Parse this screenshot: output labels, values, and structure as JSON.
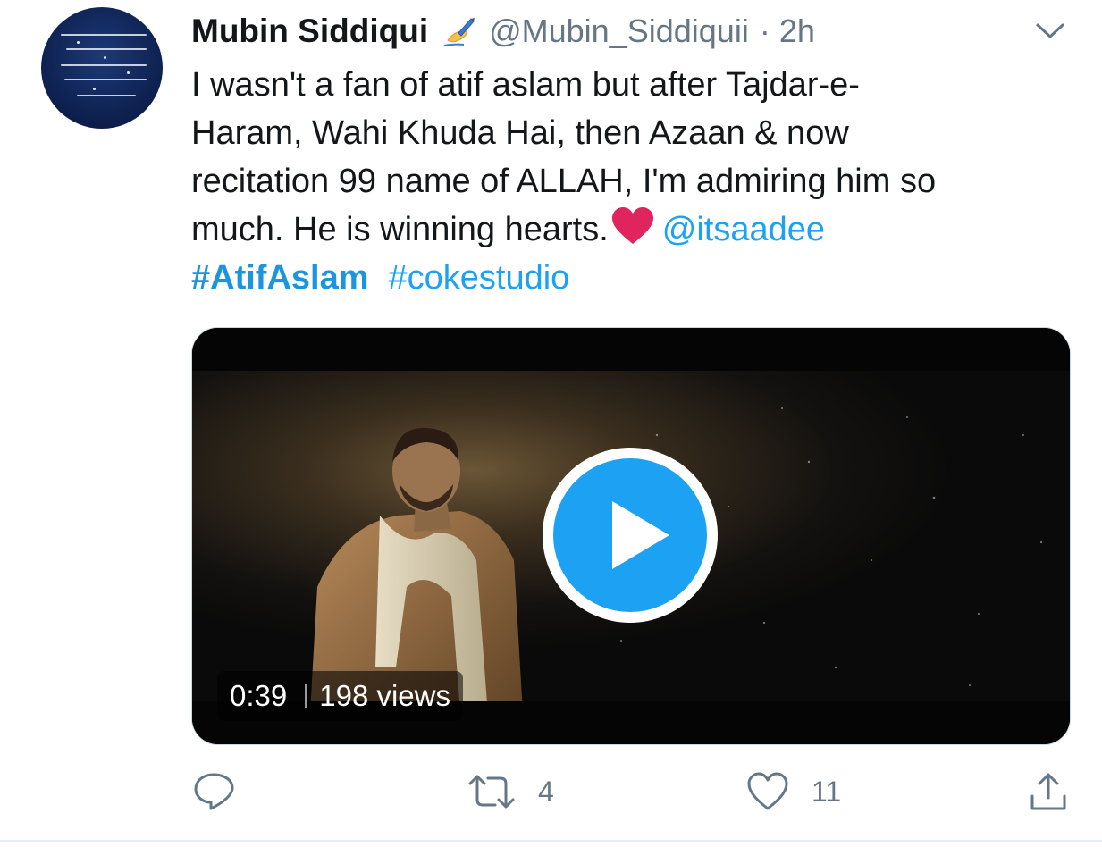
{
  "tweet": {
    "author_name": "Mubin Siddiqui",
    "author_handle": "@Mubin_Siddiquii",
    "separator": "·",
    "time": "2h",
    "avatar_icon": "calligraphy-avatar-icon",
    "name_emoji": "writing-hand-icon",
    "text_lines": [
      "I wasn't a fan of atif aslam but after Tajdar-e-",
      "Haram, Wahi Khuda Hai, then Azaan & now",
      "recitation 99 name of ALLAH, I'm admiring him so"
    ],
    "text_last": "much. He is winning hearts.",
    "mention": "@itsaadee",
    "hashtags": [
      "#AtifAslam",
      "#cokestudio"
    ],
    "video": {
      "duration": "0:39",
      "views": "198 views"
    },
    "actions": {
      "reply_count": "",
      "retweet_count": "4",
      "like_count": "11"
    }
  },
  "colors": {
    "link": "#1da1f2",
    "muted": "#657786",
    "heart": "#e0245e",
    "play": "#1da1f2"
  }
}
